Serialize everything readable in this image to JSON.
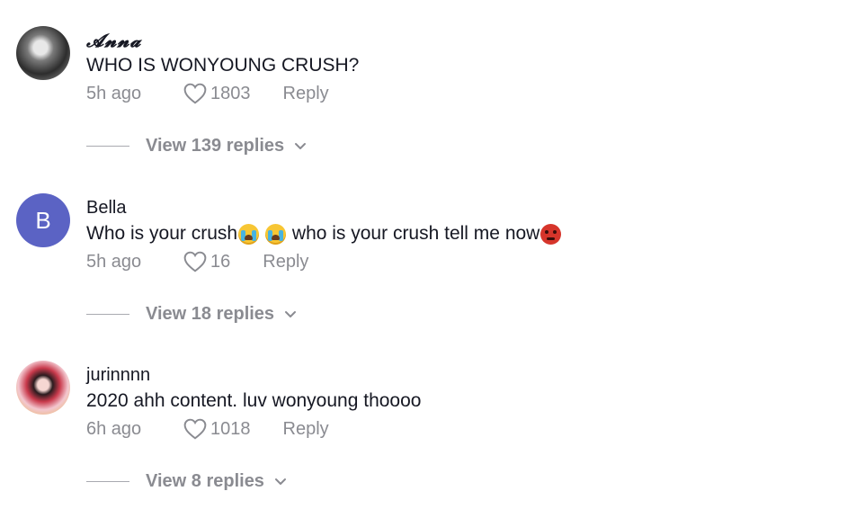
{
  "comments": [
    {
      "username": "𝓐𝓷𝓷𝓪",
      "text": "WHO IS WONYOUNG CRUSH?",
      "time": "5h ago",
      "likes": "1803",
      "reply_label": "Reply",
      "view_replies": "View 139 replies",
      "avatar": "photo"
    },
    {
      "username": "Bella",
      "text_part1": "Who is your crush",
      "text_part2": " who is your crush tell me now",
      "emojis": [
        "loudly-crying-face",
        "loudly-crying-face",
        "angry-face"
      ],
      "time": "5h ago",
      "likes": "16",
      "reply_label": "Reply",
      "view_replies": "View 18 replies",
      "avatar_letter": "B",
      "avatar_color": "#5b63c4"
    },
    {
      "username": "jurinnnn",
      "text": "2020 ahh content. luv wonyoung thoooo",
      "time": "6h ago",
      "likes": "1018",
      "reply_label": "Reply",
      "view_replies": "View 8 replies",
      "avatar": "photo"
    }
  ],
  "icons": {
    "like": "heart-outline-icon",
    "expand": "chevron-down-icon"
  },
  "colors": {
    "text": "#161823",
    "muted": "#8a8b91",
    "avatar_b": "#5b63c4"
  }
}
